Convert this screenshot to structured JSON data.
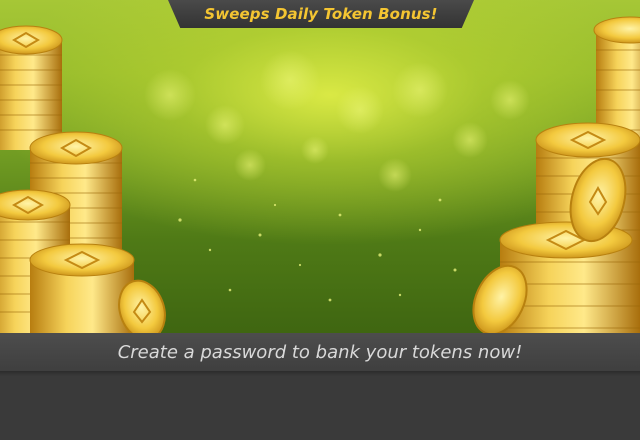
{
  "banner": {
    "title": "Sweeps Daily Token Bonus!"
  },
  "promo": {
    "caption": "Create a password to bank your tokens now!"
  },
  "colors": {
    "title_gold": "#f4c532",
    "caption_text": "#d9d9d9",
    "panel_dark": "#3a3a3a",
    "hero_green": "#8fb82c"
  },
  "illustration": {
    "subject": "gold-token-coin-stacks",
    "coin_icon": "token-coin-icon"
  }
}
